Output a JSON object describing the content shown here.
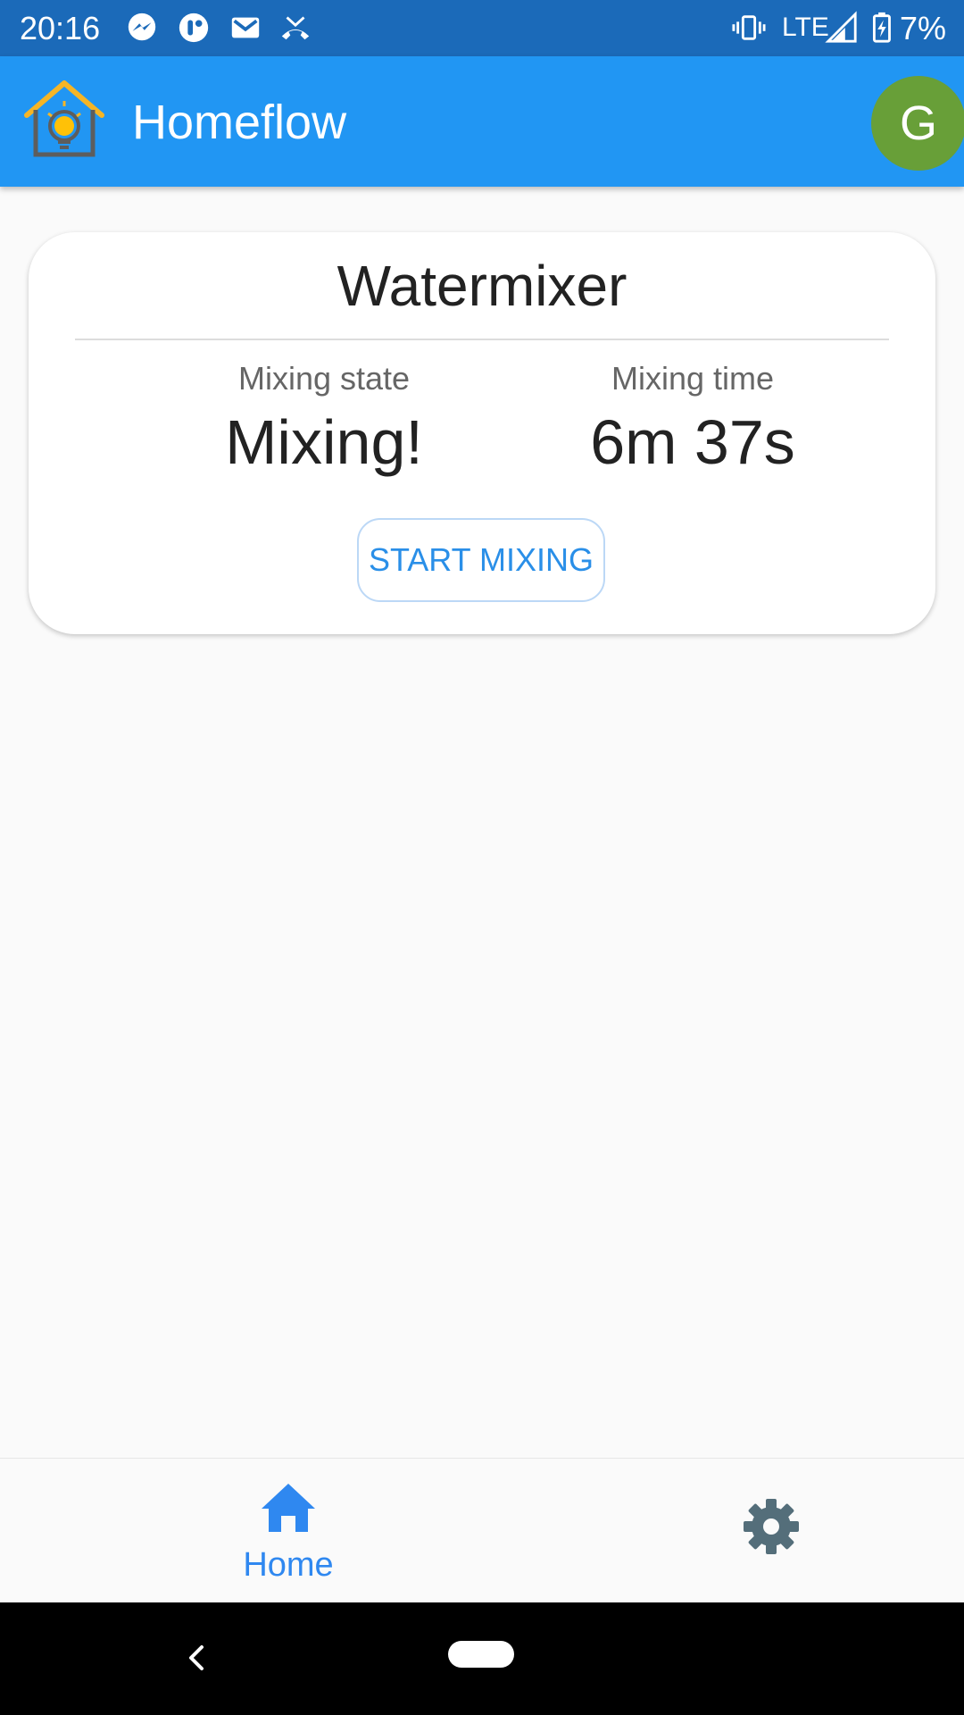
{
  "status_bar": {
    "time": "20:16",
    "network": "LTE",
    "battery": "7%",
    "icons": [
      "messenger-icon",
      "notification-app-icon",
      "gmail-icon",
      "missed-call-icon",
      "vibrate-icon",
      "signal-icon",
      "battery-charging-icon"
    ]
  },
  "app_bar": {
    "title": "Homeflow",
    "avatar_letter": "G",
    "colors": {
      "primary": "#2196f3",
      "avatar": "#689f38"
    }
  },
  "card": {
    "title": "Watermixer",
    "mixing_state": {
      "label": "Mixing state",
      "value": "Mixing!"
    },
    "mixing_time": {
      "label": "Mixing time",
      "value": "6m 37s"
    },
    "button_label": "START MIXING"
  },
  "bottom_nav": {
    "items": [
      {
        "label": "Home",
        "icon": "home-icon",
        "active": true
      },
      {
        "label": "",
        "icon": "gear-icon",
        "active": false
      }
    ],
    "active_color": "#2f88f0"
  },
  "system_nav": {
    "buttons": [
      "back",
      "home"
    ]
  }
}
